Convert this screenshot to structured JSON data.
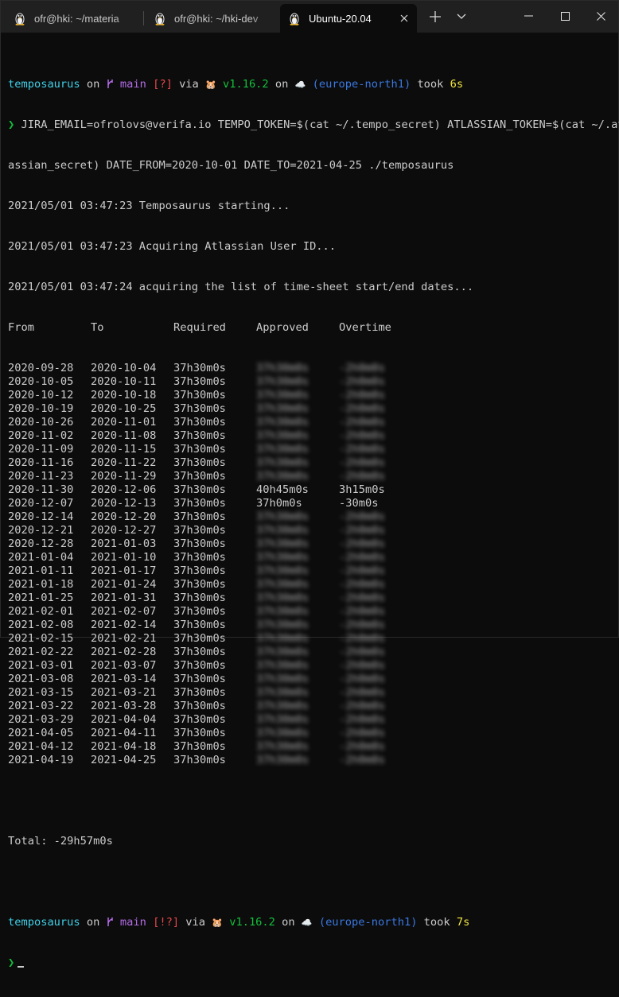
{
  "tabs": [
    {
      "label": "ofr@hki: ~/materia",
      "active": false
    },
    {
      "label": "ofr@hki: ~/hki-dev",
      "active": false
    },
    {
      "label": "Ubuntu-20.04",
      "active": true
    }
  ],
  "prompt1": {
    "user": "temposaurus",
    "on": " on ",
    "branch_icon": "git-branch-icon",
    "branch": "main",
    "status": "[?]",
    "via": " via ",
    "gopher": "🐹",
    "version": "v1.16.2",
    "on2": " on ",
    "cloud": "☁️",
    "region": "(europe-north1)",
    "took_label": " took ",
    "took": "6s"
  },
  "command": {
    "arrow": "❯",
    "line1": " JIRA_EMAIL=ofrolovs@verifa.io TEMPO_TOKEN=$(cat ~/.tempo_secret) ATLASSIAN_TOKEN=$(cat ~/.atl",
    "line2": "assian_secret) DATE_FROM=2020-10-01 DATE_TO=2021-04-25 ./temposaurus"
  },
  "log": [
    "2021/05/01 03:47:23 Temposaurus starting...",
    "2021/05/01 03:47:23 Acquiring Atlassian User ID...",
    "2021/05/01 03:47:24 acquiring the list of time-sheet start/end dates..."
  ],
  "table": {
    "headers": [
      "From",
      "To",
      "Required",
      "Approved",
      "Overtime"
    ],
    "rows": [
      [
        "2020-09-28",
        "2020-10-04",
        "37h30m0s",
        "",
        ""
      ],
      [
        "2020-10-05",
        "2020-10-11",
        "37h30m0s",
        "",
        ""
      ],
      [
        "2020-10-12",
        "2020-10-18",
        "37h30m0s",
        "",
        ""
      ],
      [
        "2020-10-19",
        "2020-10-25",
        "37h30m0s",
        "",
        ""
      ],
      [
        "2020-10-26",
        "2020-11-01",
        "37h30m0s",
        "",
        ""
      ],
      [
        "2020-11-02",
        "2020-11-08",
        "37h30m0s",
        "",
        ""
      ],
      [
        "2020-11-09",
        "2020-11-15",
        "37h30m0s",
        "",
        ""
      ],
      [
        "2020-11-16",
        "2020-11-22",
        "37h30m0s",
        "",
        ""
      ],
      [
        "2020-11-23",
        "2020-11-29",
        "37h30m0s",
        "",
        ""
      ],
      [
        "2020-11-30",
        "2020-12-06",
        "37h30m0s",
        "40h45m0s",
        "3h15m0s"
      ],
      [
        "2020-12-07",
        "2020-12-13",
        "37h30m0s",
        "37h0m0s",
        "-30m0s"
      ],
      [
        "2020-12-14",
        "2020-12-20",
        "37h30m0s",
        "",
        ""
      ],
      [
        "2020-12-21",
        "2020-12-27",
        "37h30m0s",
        "",
        ""
      ],
      [
        "2020-12-28",
        "2021-01-03",
        "37h30m0s",
        "",
        ""
      ],
      [
        "2021-01-04",
        "2021-01-10",
        "37h30m0s",
        "",
        ""
      ],
      [
        "2021-01-11",
        "2021-01-17",
        "37h30m0s",
        "",
        ""
      ],
      [
        "2021-01-18",
        "2021-01-24",
        "37h30m0s",
        "",
        ""
      ],
      [
        "2021-01-25",
        "2021-01-31",
        "37h30m0s",
        "",
        ""
      ],
      [
        "2021-02-01",
        "2021-02-07",
        "37h30m0s",
        "",
        ""
      ],
      [
        "2021-02-08",
        "2021-02-14",
        "37h30m0s",
        "",
        ""
      ],
      [
        "2021-02-15",
        "2021-02-21",
        "37h30m0s",
        "",
        ""
      ],
      [
        "2021-02-22",
        "2021-02-28",
        "37h30m0s",
        "",
        ""
      ],
      [
        "2021-03-01",
        "2021-03-07",
        "37h30m0s",
        "",
        ""
      ],
      [
        "2021-03-08",
        "2021-03-14",
        "37h30m0s",
        "",
        ""
      ],
      [
        "2021-03-15",
        "2021-03-21",
        "37h30m0s",
        "",
        ""
      ],
      [
        "2021-03-22",
        "2021-03-28",
        "37h30m0s",
        "",
        ""
      ],
      [
        "2021-03-29",
        "2021-04-04",
        "37h30m0s",
        "",
        ""
      ],
      [
        "2021-04-05",
        "2021-04-11",
        "37h30m0s",
        "",
        ""
      ],
      [
        "2021-04-12",
        "2021-04-18",
        "37h30m0s",
        "",
        ""
      ],
      [
        "2021-04-19",
        "2021-04-25",
        "37h30m0s",
        "",
        ""
      ]
    ]
  },
  "total": "Total: -29h57m0s",
  "prompt2": {
    "user": "temposaurus",
    "on": " on ",
    "branch": "main",
    "status": "[!?]",
    "via": " via ",
    "gopher": "🐹",
    "version": "v1.16.2",
    "on2": " on ",
    "cloud": "☁️",
    "region": "(europe-north1)",
    "took_label": " took ",
    "took": "7s"
  },
  "prompt_arrow": "❯",
  "colors": {
    "background": "#0c0c0c",
    "tabbar": "#202020",
    "user": "#3fd0e8",
    "branch": "#b46ce8",
    "status": "#e8474b",
    "version": "#13c13b",
    "region": "#3a78e0",
    "took": "#f0e442"
  }
}
